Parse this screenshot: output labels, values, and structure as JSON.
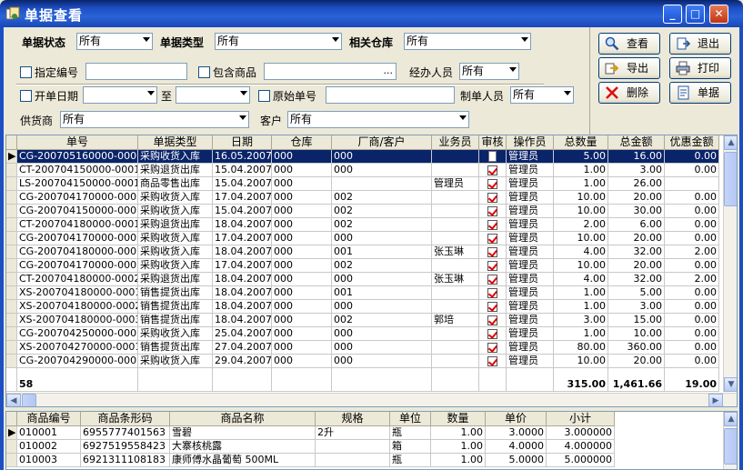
{
  "window": {
    "title": "单据查看"
  },
  "filters": {
    "status_label": "单据状态",
    "status_value": "所有",
    "type_label": "单据类型",
    "type_value": "所有",
    "warehouse_label": "相关仓库",
    "warehouse_value": "所有",
    "code_label": "指定编号",
    "code_value": "",
    "goods_label": "包含商品",
    "goods_value": "",
    "goods_btn": "...",
    "handler_label": "经办人员",
    "handler_value": "所有",
    "date_label": "开单日期",
    "date_from": "",
    "date_to_label": "至",
    "date_to": "",
    "original_label": "原始单号",
    "original_value": "",
    "maker_label": "制单人员",
    "maker_value": "所有",
    "supplier_label": "供货商",
    "supplier_value": "所有",
    "customer_label": "客户",
    "customer_value": "所有"
  },
  "buttons": {
    "query": "查看",
    "exit": "退出",
    "export": "导出",
    "print": "打印",
    "delete": "删除",
    "doc": "单据"
  },
  "main_table": {
    "headers": [
      "单号",
      "单据类型",
      "日期",
      "仓库",
      "厂商/客户",
      "业务员",
      "审核",
      "操作员",
      "总数量",
      "总金额",
      "优惠金额"
    ],
    "rows": [
      [
        "CG-200705160000-0001",
        "采购收货入库",
        "16.05.2007",
        "000",
        "000",
        "",
        "doc",
        "管理员",
        "5.00",
        "16.00",
        "0.00"
      ],
      [
        "CT-200704150000-0001",
        "采购退货出库",
        "15.04.2007",
        "000",
        "000",
        "",
        "check",
        "管理员",
        "1.00",
        "3.00",
        "0.00"
      ],
      [
        "LS-200704150000-0001",
        "商品零售出库",
        "15.04.2007",
        "000",
        "",
        "管理员",
        "check",
        "管理员",
        "1.00",
        "26.00",
        ""
      ],
      [
        "CG-200704170000-0001",
        "采购收货入库",
        "17.04.2007",
        "000",
        "002",
        "",
        "check",
        "管理员",
        "10.00",
        "20.00",
        "0.00"
      ],
      [
        "CG-200704150000-0001",
        "采购收货入库",
        "15.04.2007",
        "000",
        "002",
        "",
        "check",
        "管理员",
        "10.00",
        "30.00",
        "0.00"
      ],
      [
        "CT-200704180000-0001",
        "采购退货出库",
        "18.04.2007",
        "000",
        "002",
        "",
        "check",
        "管理员",
        "2.00",
        "6.00",
        "0.00"
      ],
      [
        "CG-200704170000-0002",
        "采购收货入库",
        "17.04.2007",
        "000",
        "000",
        "",
        "check",
        "管理员",
        "10.00",
        "20.00",
        "0.00"
      ],
      [
        "CG-200704180000-0001",
        "采购收货入库",
        "18.04.2007",
        "000",
        "001",
        "张玉琳",
        "check",
        "管理员",
        "4.00",
        "32.00",
        "2.00"
      ],
      [
        "CG-200704170000-0003",
        "采购收货入库",
        "17.04.2007",
        "000",
        "002",
        "",
        "check",
        "管理员",
        "10.00",
        "20.00",
        "0.00"
      ],
      [
        "CT-200704180000-0002",
        "采购退货出库",
        "18.04.2007",
        "000",
        "000",
        "张玉琳",
        "check",
        "管理员",
        "4.00",
        "32.00",
        "2.00"
      ],
      [
        "XS-200704180000-0001",
        "销售提货出库",
        "18.04.2007",
        "000",
        "001",
        "",
        "check",
        "管理员",
        "1.00",
        "5.00",
        "0.00"
      ],
      [
        "XS-200704180000-0002",
        "销售提货出库",
        "18.04.2007",
        "000",
        "000",
        "",
        "check",
        "管理员",
        "1.00",
        "3.00",
        "0.00"
      ],
      [
        "XS-200704180000-0003",
        "销售提货出库",
        "18.04.2007",
        "000",
        "002",
        "郭培",
        "check",
        "管理员",
        "3.00",
        "15.00",
        "0.00"
      ],
      [
        "CG-200704250000-0001",
        "采购收货入库",
        "25.04.2007",
        "000",
        "000",
        "",
        "check",
        "管理员",
        "1.00",
        "10.00",
        "0.00"
      ],
      [
        "XS-200704270000-0001",
        "销售提货出库",
        "27.04.2007",
        "000",
        "000",
        "",
        "check",
        "管理员",
        "80.00",
        "360.00",
        "0.00"
      ],
      [
        "CG-200704290000-0001",
        "采购收货入库",
        "29.04.2007",
        "000",
        "000",
        "",
        "check",
        "管理员",
        "10.00",
        "20.00",
        "0.00"
      ]
    ],
    "footer": {
      "count": "58",
      "total_qty": "315.00",
      "total_amount": "1,461.66",
      "total_discount": "19.00"
    }
  },
  "detail_table": {
    "headers": [
      "商品编号",
      "商品条形码",
      "商品名称",
      "规格",
      "单位",
      "数量",
      "单价",
      "小计"
    ],
    "rows": [
      [
        "010001",
        "6955777401563",
        "雪碧",
        "2升",
        "瓶",
        "1.00",
        "3.0000",
        "3.000000"
      ],
      [
        "010002",
        "6927519558423",
        "大寨核桃露",
        "",
        "箱",
        "1.00",
        "4.0000",
        "4.000000"
      ],
      [
        "010003",
        "6921311108183",
        "康师傅水晶葡萄 500ML",
        "",
        "瓶",
        "1.00",
        "5.0000",
        "5.000000"
      ]
    ]
  }
}
